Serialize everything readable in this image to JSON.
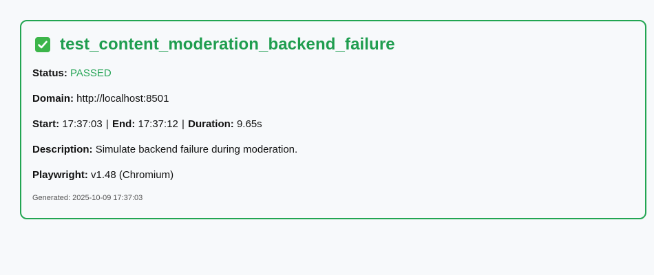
{
  "test": {
    "title": "test_content_moderation_backend_failure",
    "status_label": "Status:",
    "status_value": "PASSED",
    "domain_label": "Domain:",
    "domain_value": "http://localhost:8501",
    "start_label": "Start:",
    "start_value": "17:37:03",
    "end_label": "End:",
    "end_value": "17:37:12",
    "duration_label": "Duration:",
    "duration_value": "9.65s",
    "separator": "|",
    "description_label": "Description:",
    "description_value": "Simulate backend failure during moderation.",
    "playwright_label": "Playwright:",
    "playwright_value": "v1.48 (Chromium)",
    "generated": "Generated: 2025-10-09 17:37:03"
  },
  "colors": {
    "accent": "#1f9d4f",
    "border": "#22a552",
    "check_bg": "#3cb54a",
    "background": "#f7f9fb"
  },
  "icons": {
    "title_icon": "check-mark-button-icon"
  }
}
